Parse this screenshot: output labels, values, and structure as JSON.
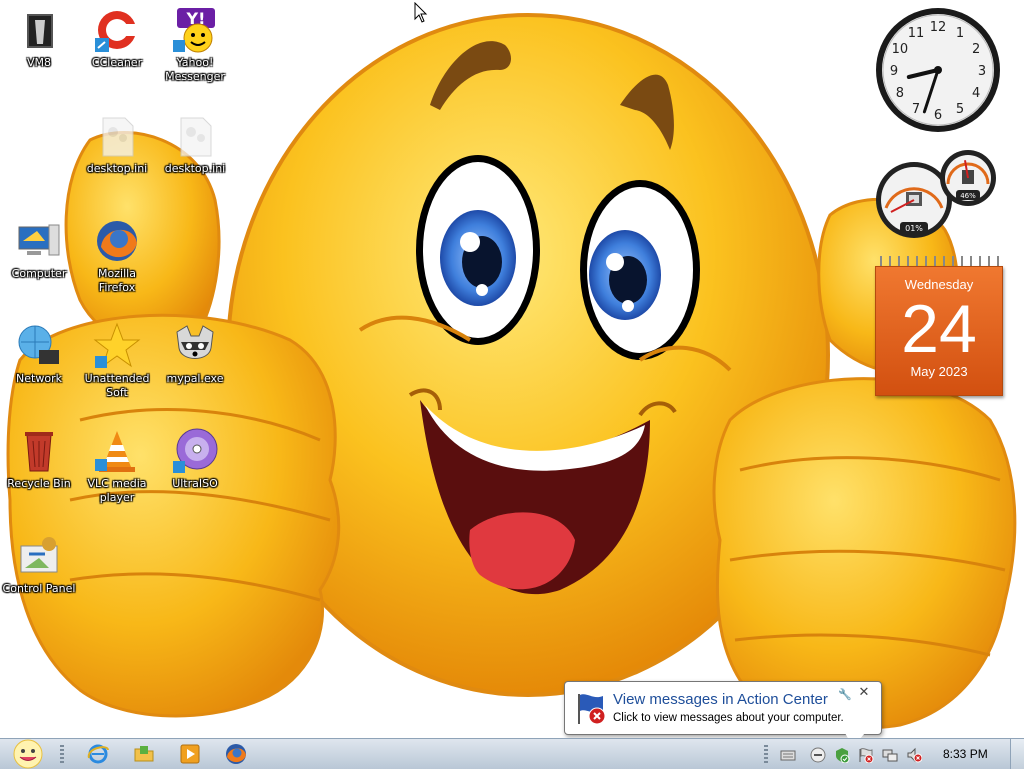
{
  "desktop": {
    "icons": [
      {
        "id": "vm8",
        "label": "VM8"
      },
      {
        "id": "ccleaner",
        "label": "CCleaner"
      },
      {
        "id": "yahoo",
        "label": "Yahoo!\nMessenger"
      },
      {
        "id": "desktop-ini-1",
        "label": "desktop.ini"
      },
      {
        "id": "desktop-ini-2",
        "label": "desktop.ini"
      },
      {
        "id": "computer",
        "label": "Computer"
      },
      {
        "id": "firefox",
        "label": "Mozilla\nFirefox"
      },
      {
        "id": "network",
        "label": "Network"
      },
      {
        "id": "unattended",
        "label": "Unattended\nSoft"
      },
      {
        "id": "mypal",
        "label": "mypal.exe"
      },
      {
        "id": "recycle",
        "label": "Recycle Bin"
      },
      {
        "id": "vlc",
        "label": "VLC media\nplayer"
      },
      {
        "id": "ultraiso",
        "label": "UltraISO"
      },
      {
        "id": "control",
        "label": "Control Panel"
      }
    ]
  },
  "gadgets": {
    "clock": {
      "numerals": [
        "12",
        "1",
        "2",
        "3",
        "4",
        "5",
        "6",
        "7",
        "8",
        "9",
        "10",
        "11"
      ],
      "hour": 8,
      "minute": 33
    },
    "meter": {
      "cpu_label": "01%",
      "ram_label": "46%",
      "cpu": 0.01,
      "ram": 0.46
    },
    "calendar": {
      "weekday": "Wednesday",
      "day": "24",
      "month_year": "May 2023"
    }
  },
  "notification": {
    "title": "View messages in Action Center",
    "text": "Click to view messages about your computer."
  },
  "taskbar": {
    "time": "8:33 PM",
    "pinned": [
      "ie-icon",
      "explorer-icon",
      "media-player-icon",
      "firefox-icon"
    ],
    "tray": [
      "keyboard-icon",
      "messenger-icon",
      "security-icon",
      "action-center-icon",
      "network-icon",
      "volume-muted-icon"
    ]
  },
  "colors": {
    "taskbar": "#c9d5e2",
    "calendar": "#e0601c",
    "balloon_title": "#1e4e9a",
    "smiley": "#fbbf1a"
  }
}
